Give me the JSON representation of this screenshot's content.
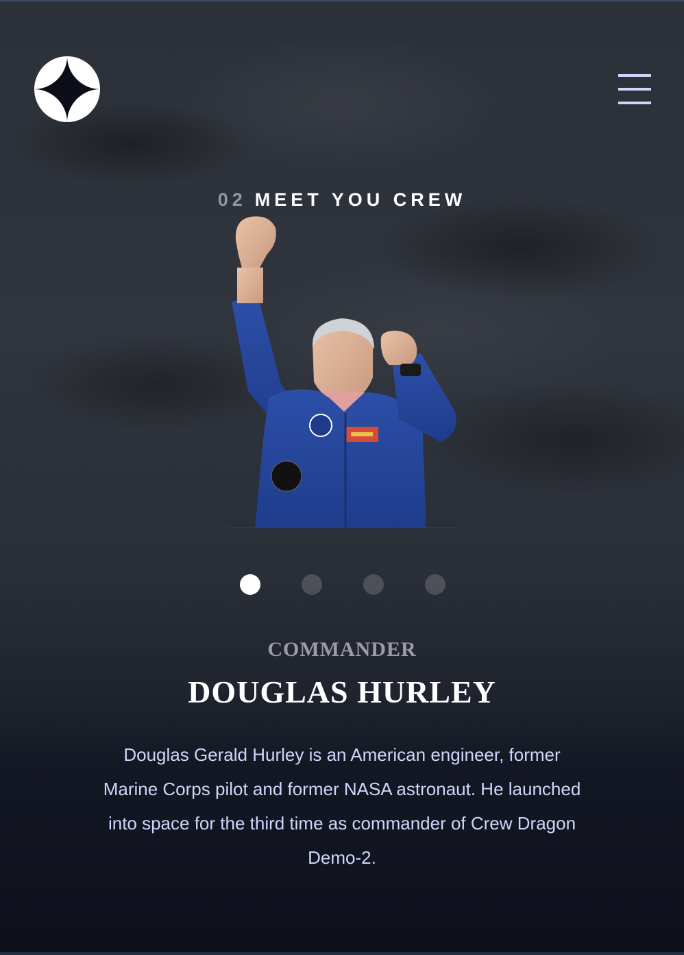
{
  "header": {
    "logo_icon": "four-point-star-icon",
    "menu_icon": "hamburger-menu-icon"
  },
  "page_heading": {
    "number": "02",
    "title": "MEET YOU CREW"
  },
  "crew": {
    "image_alt": "Douglas Hurley",
    "role": "COMMANDER",
    "name": "DOUGLAS HURLEY",
    "bio": "Douglas Gerald Hurley is an American engineer, former Marine Corps pilot and former NASA astronaut. He launched into space for the third time as commander of Crew Dragon Demo-2."
  },
  "slider": {
    "count": 4,
    "active_index": 0
  },
  "colors": {
    "background": "#0b0d17",
    "accent_text": "#d0d6f9",
    "muted_text": "#9a9da6",
    "white": "#ffffff"
  }
}
